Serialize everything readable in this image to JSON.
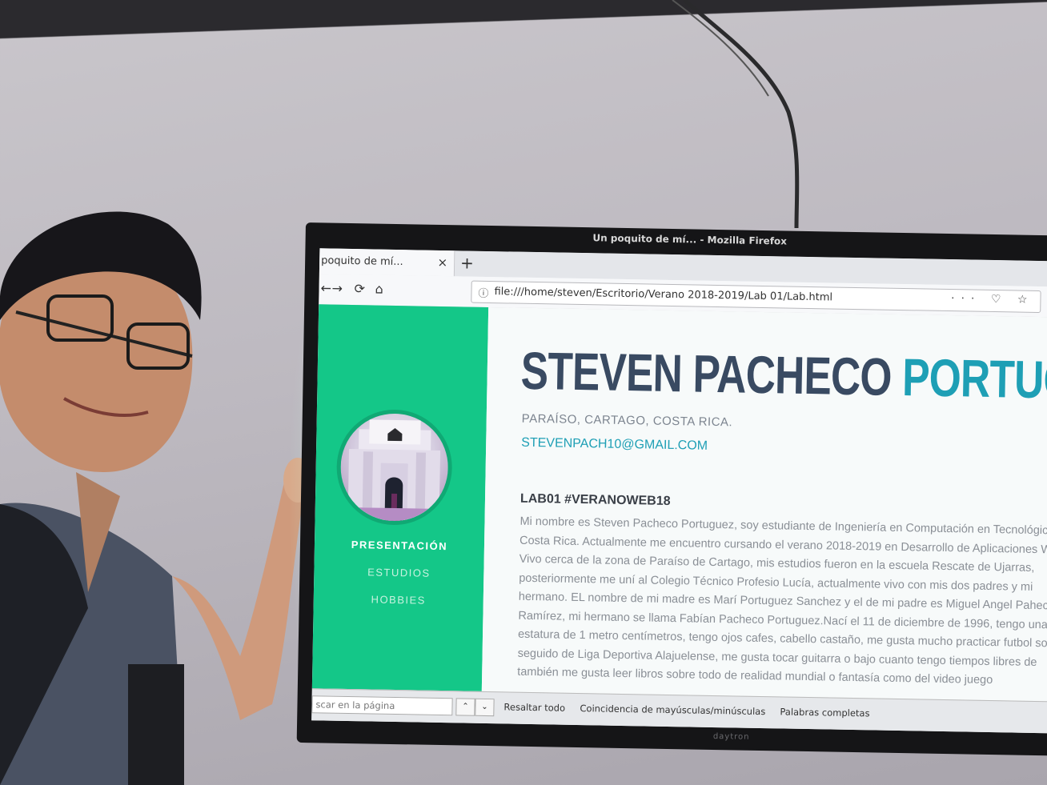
{
  "window": {
    "title": "Un poquito de mí... - Mozilla Firefox"
  },
  "tab": {
    "title": "poquito de mí...",
    "close": "×",
    "new": "+"
  },
  "nav": {
    "back": "←",
    "forward": "→",
    "reload": "⟳",
    "home": "⌂"
  },
  "url": {
    "info": "ⓘ",
    "value": "file:///home/steven/Escritorio/Verano 2018-2019/Lab 01/Lab.html",
    "actions": "··· ♡ ☆"
  },
  "sidebar": {
    "items": [
      {
        "label": "PRESENTACIÓN",
        "active": true
      },
      {
        "label": "ESTUDIOS",
        "active": false
      },
      {
        "label": "HOBBIES",
        "active": false
      }
    ]
  },
  "header": {
    "first_name": "STEVEN PACHECO",
    "last_name": "PORTUGU",
    "location": "Paraíso, Cartago, Costa Rica.",
    "email": "stevenpach10@gmail.com"
  },
  "section": {
    "title": "LAB01 #VERANOWEB18",
    "bio": "Mi nombre es Steven Pacheco Portuguez, soy estudiante de Ingeniería en Computación en Tecnológico de Costa Rica. Actualmente me encuentro cursando el verano 2018-2019 en Desarrollo de Aplicaciones Web. Vivo cerca de la zona de Paraíso de Cartago, mis estudios fueron en la escuela Rescate de Ujarras, posteriormente me uní al Colegio Técnico Profesio Lucía, actualmente vivo con mis dos padres y mi hermano. EL nombre de mi madre es Marí Portuguez Sanchez y el de mi padre es Miguel Angel Paheco Ramírez, mi hermano se llama Fabían Pacheco Portuguez.Nací el 11 de diciembre de 1996, tengo una estatura de 1 metro centímetros, tengo ojos cafes, cabello castaño, me gusta mucho practicar futbol soy seguido de Liga Deportiva Alajuelense, me gusta tocar guitarra o bajo cuanto tengo tiempos libres de también me gusta leer libros sobre todo de realidad mundial o fantasía como del video juego"
  },
  "findbar": {
    "placeholder": "scar en la página",
    "up": "⌃",
    "down": "⌄",
    "highlight": "Resaltar todo",
    "match_case": "Coincidencia de mayúsculas/minúsculas",
    "whole_words": "Palabras completas"
  },
  "tv_brand": "daytron",
  "colors": {
    "sidebar": "#14c788",
    "name_dark": "#394a62",
    "name_accent": "#1e9fb5"
  }
}
